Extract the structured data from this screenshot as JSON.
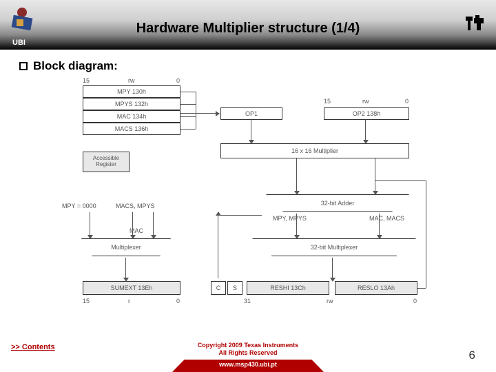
{
  "header": {
    "title": "Hardware Multiplier structure (1/4)",
    "ubi": "UBI"
  },
  "bullet": {
    "text": "Block diagram:"
  },
  "diagram": {
    "bits": {
      "b15": "15",
      "b0": "0",
      "rw": "rw",
      "r": "r",
      "b31": "31"
    },
    "regs": {
      "mpy": "MPY 130h",
      "mpys": "MPYS 132h",
      "mac": "MAC 134h",
      "macs": "MACS 136h",
      "accessible": "Accessible Register",
      "op1": "OP1",
      "op2": "OP2 138h",
      "mult": "16 x 16 Multiplier",
      "adder": "32-bit Adder",
      "mux": "Multiplexer",
      "bigmux": "32-bit Multiplexer",
      "sumext": "SUMEXT 13Eh",
      "reshi": "RESHI 13Ch",
      "reslo": "RESLO 13Ah",
      "c": "C",
      "s": "S"
    },
    "labels": {
      "mpy0000": "MPY = 0000",
      "macs_mpys": "MACS, MPYS",
      "mac_lbl": "MAC",
      "mpy_mpys": "MPY, MPYS",
      "mac_macs": "MAC, MACS"
    }
  },
  "footer": {
    "contents": ">> Contents",
    "copyright1": "Copyright  2009 Texas Instruments",
    "copyright2": "All Rights Reserved",
    "url": "www.msp430.ubi.pt",
    "page": "6"
  }
}
